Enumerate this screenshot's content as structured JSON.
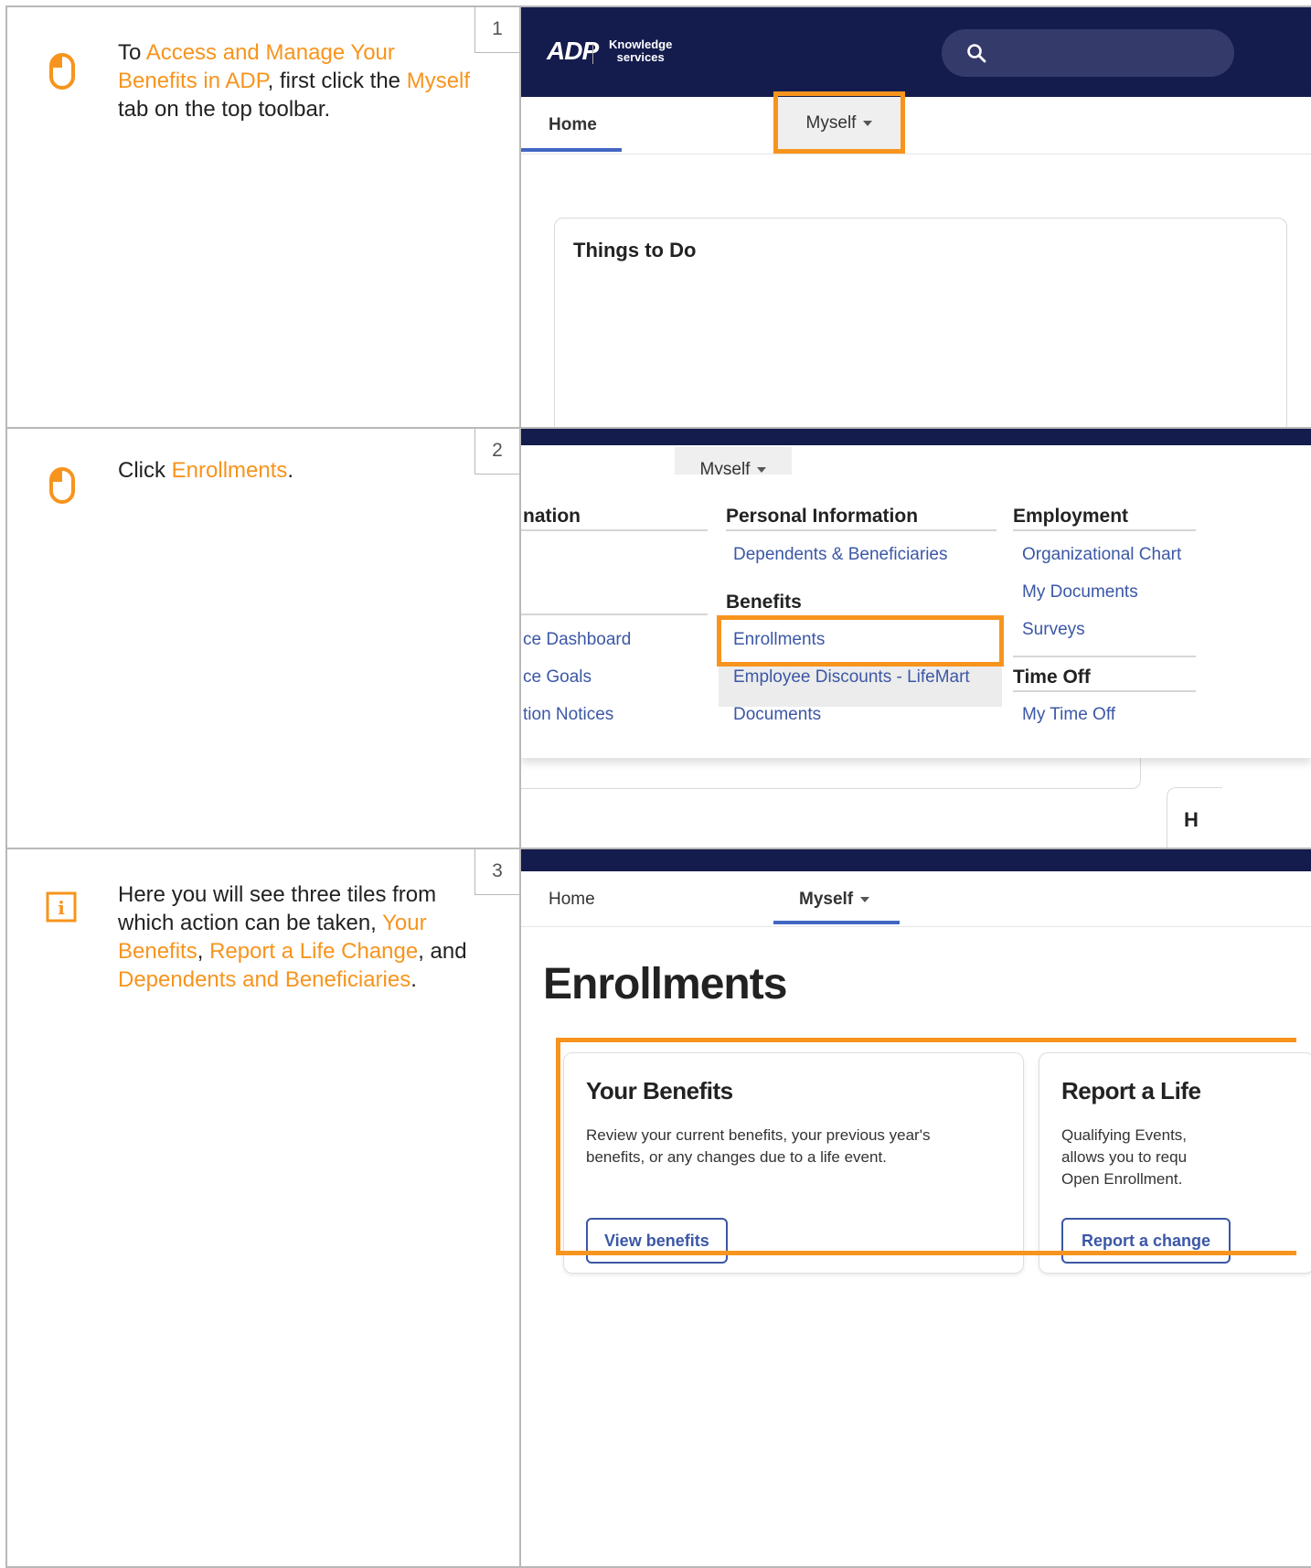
{
  "steps": [
    {
      "number": "1",
      "icon": "mouse-icon",
      "text": {
        "p1": "To ",
        "h1": "Access and Manage Your Benefits in ADP",
        "p2": ", first click the ",
        "h2": "Myself",
        "p3": " tab on the top toolbar."
      },
      "screen": {
        "logo_adp": "ADP",
        "logo_ks_line1": "Knowledge",
        "logo_ks_line2": "services",
        "nav_home": "Home",
        "nav_myself": "Myself",
        "card_title": "Things to Do"
      }
    },
    {
      "number": "2",
      "icon": "mouse-icon",
      "text": {
        "p1": "Click ",
        "h1": "Enrollments",
        "p2": "."
      },
      "screen": {
        "nav_myself": "Myself",
        "col0_head": "nation",
        "col0_links": [
          "ce Dashboard",
          "ce Goals",
          "tion Notices"
        ],
        "personal_head": "Personal Information",
        "personal_links": [
          "Dependents & Beneficiaries"
        ],
        "benefits_head": "Benefits",
        "benefits_links": [
          "Enrollments",
          "Employee Discounts - LifeMart",
          "Documents"
        ],
        "employment_head": "Employment",
        "employment_links": [
          "Organizational Chart",
          "My Documents",
          "Surveys"
        ],
        "timeoff_head": "Time Off",
        "timeoff_links": [
          "My Time Off"
        ],
        "peek_text": "H"
      }
    },
    {
      "number": "3",
      "icon": "info-icon",
      "text": {
        "p1": "Here you will see three tiles from which action can be taken, ",
        "h1": "Your Benefits",
        "p2": ", ",
        "h2": "Report a Life Change",
        "p3": ", and ",
        "h3": "Dependents and Beneficiaries",
        "p4": "."
      },
      "screen": {
        "nav_home": "Home",
        "nav_myself": "Myself",
        "page_title": "Enrollments",
        "tiles": [
          {
            "title": "Your Benefits",
            "desc": "Review your current benefits, your previous year's benefits, or any changes due to a life event.",
            "button": "View benefits"
          },
          {
            "title": "Report a Life",
            "desc": "Qualifying Events, allows you to requ Open Enrollment.",
            "button": "Report a change"
          }
        ]
      }
    }
  ],
  "colors": {
    "accent": "#f7941d",
    "navy": "#141b4d",
    "link": "#3b57a6"
  }
}
